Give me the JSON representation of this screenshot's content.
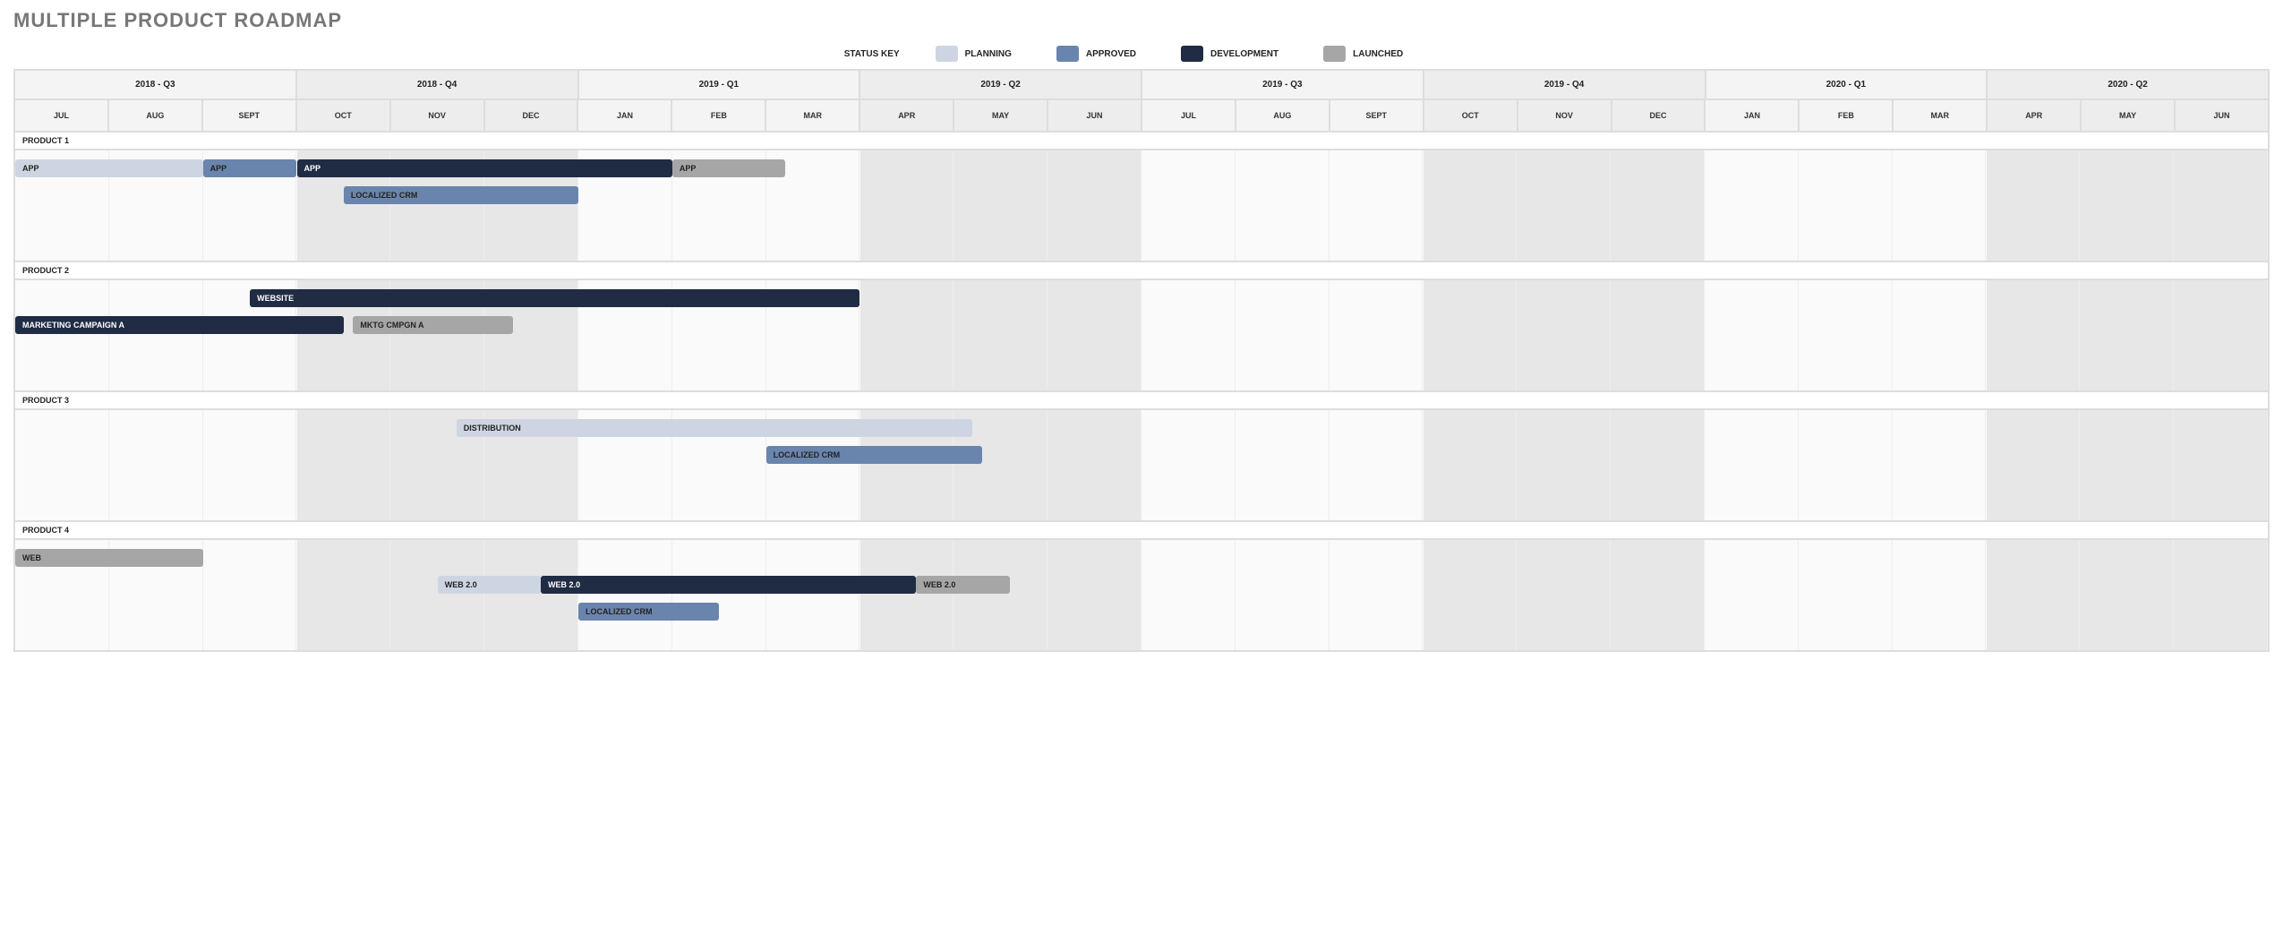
{
  "title": "MULTIPLE PRODUCT ROADMAP",
  "status_key": {
    "label": "STATUS KEY",
    "items": [
      {
        "name": "PLANNING",
        "class": "c-planning"
      },
      {
        "name": "APPROVED",
        "class": "c-approved"
      },
      {
        "name": "DEVELOPMENT",
        "class": "c-development"
      },
      {
        "name": "LAUNCHED",
        "class": "c-launched"
      }
    ]
  },
  "quarters": [
    {
      "label": "2018 - Q3",
      "shade": "light"
    },
    {
      "label": "2018 - Q4",
      "shade": ""
    },
    {
      "label": "2019 - Q1",
      "shade": "light"
    },
    {
      "label": "2019 - Q2",
      "shade": ""
    },
    {
      "label": "2019 - Q3",
      "shade": "light"
    },
    {
      "label": "2019 - Q4",
      "shade": ""
    },
    {
      "label": "2020 - Q1",
      "shade": "light"
    },
    {
      "label": "2020 - Q2",
      "shade": ""
    }
  ],
  "months": [
    "JUL",
    "AUG",
    "SEPT",
    "OCT",
    "NOV",
    "DEC",
    "JAN",
    "FEB",
    "MAR",
    "APR",
    "MAY",
    "JUN",
    "JUL",
    "AUG",
    "SEPT",
    "OCT",
    "NOV",
    "DEC",
    "JAN",
    "FEB",
    "MAR",
    "APR",
    "MAY",
    "JUN"
  ],
  "products": [
    {
      "name": "PRODUCT 1",
      "bars": [
        {
          "label": "APP",
          "start": 0,
          "span": 2,
          "row": 0,
          "status": "planning"
        },
        {
          "label": "APP",
          "start": 2,
          "span": 1,
          "row": 0,
          "status": "approved"
        },
        {
          "label": "APP",
          "start": 3,
          "span": 4,
          "row": 0,
          "status": "development"
        },
        {
          "label": "APP",
          "start": 7,
          "span": 1.2,
          "row": 0,
          "status": "launched"
        },
        {
          "label": "LOCALIZED CRM",
          "start": 3.5,
          "span": 2.5,
          "row": 1,
          "status": "approved"
        }
      ]
    },
    {
      "name": "PRODUCT 2",
      "bars": [
        {
          "label": "WEBSITE",
          "start": 2.5,
          "span": 6.5,
          "row": 0,
          "status": "development"
        },
        {
          "label": "MARKETING CAMPAIGN A",
          "start": 0,
          "span": 3.5,
          "row": 1,
          "status": "development"
        },
        {
          "label": "MKTG CMPGN A",
          "start": 3.6,
          "span": 1.7,
          "row": 1,
          "status": "launched"
        }
      ]
    },
    {
      "name": "PRODUCT 3",
      "bars": [
        {
          "label": "DISTRIBUTION",
          "start": 4.7,
          "span": 5.5,
          "row": 0,
          "status": "planning"
        },
        {
          "label": "LOCALIZED CRM",
          "start": 8,
          "span": 2.3,
          "row": 1,
          "status": "approved"
        }
      ]
    },
    {
      "name": "PRODUCT 4",
      "bars": [
        {
          "label": "WEB",
          "start": 0,
          "span": 2,
          "row": 0,
          "status": "launched"
        },
        {
          "label": "WEB 2.0",
          "start": 4.5,
          "span": 1.1,
          "row": 1,
          "status": "planning"
        },
        {
          "label": "WEB 2.0",
          "start": 5.6,
          "span": 4,
          "row": 1,
          "status": "development"
        },
        {
          "label": "WEB 2.0",
          "start": 9.6,
          "span": 1,
          "row": 1,
          "status": "launched"
        },
        {
          "label": "LOCALIZED CRM",
          "start": 6,
          "span": 1.5,
          "row": 2,
          "status": "approved"
        }
      ]
    }
  ],
  "chart_data": {
    "type": "gantt",
    "title": "MULTIPLE PRODUCT ROADMAP",
    "x_axis": {
      "unit": "month",
      "start": "2018-07",
      "end": "2020-06",
      "labels": [
        "JUL",
        "AUG",
        "SEPT",
        "OCT",
        "NOV",
        "DEC",
        "JAN",
        "FEB",
        "MAR",
        "APR",
        "MAY",
        "JUN",
        "JUL",
        "AUG",
        "SEPT",
        "OCT",
        "NOV",
        "DEC",
        "JAN",
        "FEB",
        "MAR",
        "APR",
        "MAY",
        "JUN"
      ]
    },
    "quarters": [
      "2018 - Q3",
      "2018 - Q4",
      "2019 - Q1",
      "2019 - Q2",
      "2019 - Q3",
      "2019 - Q4",
      "2020 - Q1",
      "2020 - Q2"
    ],
    "status_colors": {
      "planning": "#ced5e2",
      "approved": "#6a85ad",
      "development": "#1f2c44",
      "launched": "#a6a6a6"
    },
    "series": [
      {
        "product": "PRODUCT 1",
        "task": "APP",
        "status": "planning",
        "start_month": 0,
        "duration_months": 2
      },
      {
        "product": "PRODUCT 1",
        "task": "APP",
        "status": "approved",
        "start_month": 2,
        "duration_months": 1
      },
      {
        "product": "PRODUCT 1",
        "task": "APP",
        "status": "development",
        "start_month": 3,
        "duration_months": 4
      },
      {
        "product": "PRODUCT 1",
        "task": "APP",
        "status": "launched",
        "start_month": 7,
        "duration_months": 1.2
      },
      {
        "product": "PRODUCT 1",
        "task": "LOCALIZED CRM",
        "status": "approved",
        "start_month": 3.5,
        "duration_months": 2.5
      },
      {
        "product": "PRODUCT 2",
        "task": "WEBSITE",
        "status": "development",
        "start_month": 2.5,
        "duration_months": 6.5
      },
      {
        "product": "PRODUCT 2",
        "task": "MARKETING CAMPAIGN A",
        "status": "development",
        "start_month": 0,
        "duration_months": 3.5
      },
      {
        "product": "PRODUCT 2",
        "task": "MKTG CMPGN A",
        "status": "launched",
        "start_month": 3.6,
        "duration_months": 1.7
      },
      {
        "product": "PRODUCT 3",
        "task": "DISTRIBUTION",
        "status": "planning",
        "start_month": 4.7,
        "duration_months": 5.5
      },
      {
        "product": "PRODUCT 3",
        "task": "LOCALIZED CRM",
        "status": "approved",
        "start_month": 8,
        "duration_months": 2.3
      },
      {
        "product": "PRODUCT 4",
        "task": "WEB",
        "status": "launched",
        "start_month": 0,
        "duration_months": 2
      },
      {
        "product": "PRODUCT 4",
        "task": "WEB 2.0",
        "status": "planning",
        "start_month": 4.5,
        "duration_months": 1.1
      },
      {
        "product": "PRODUCT 4",
        "task": "WEB 2.0",
        "status": "development",
        "start_month": 5.6,
        "duration_months": 4
      },
      {
        "product": "PRODUCT 4",
        "task": "WEB 2.0",
        "status": "launched",
        "start_month": 9.6,
        "duration_months": 1
      },
      {
        "product": "PRODUCT 4",
        "task": "LOCALIZED CRM",
        "status": "approved",
        "start_month": 6,
        "duration_months": 1.5
      }
    ]
  }
}
